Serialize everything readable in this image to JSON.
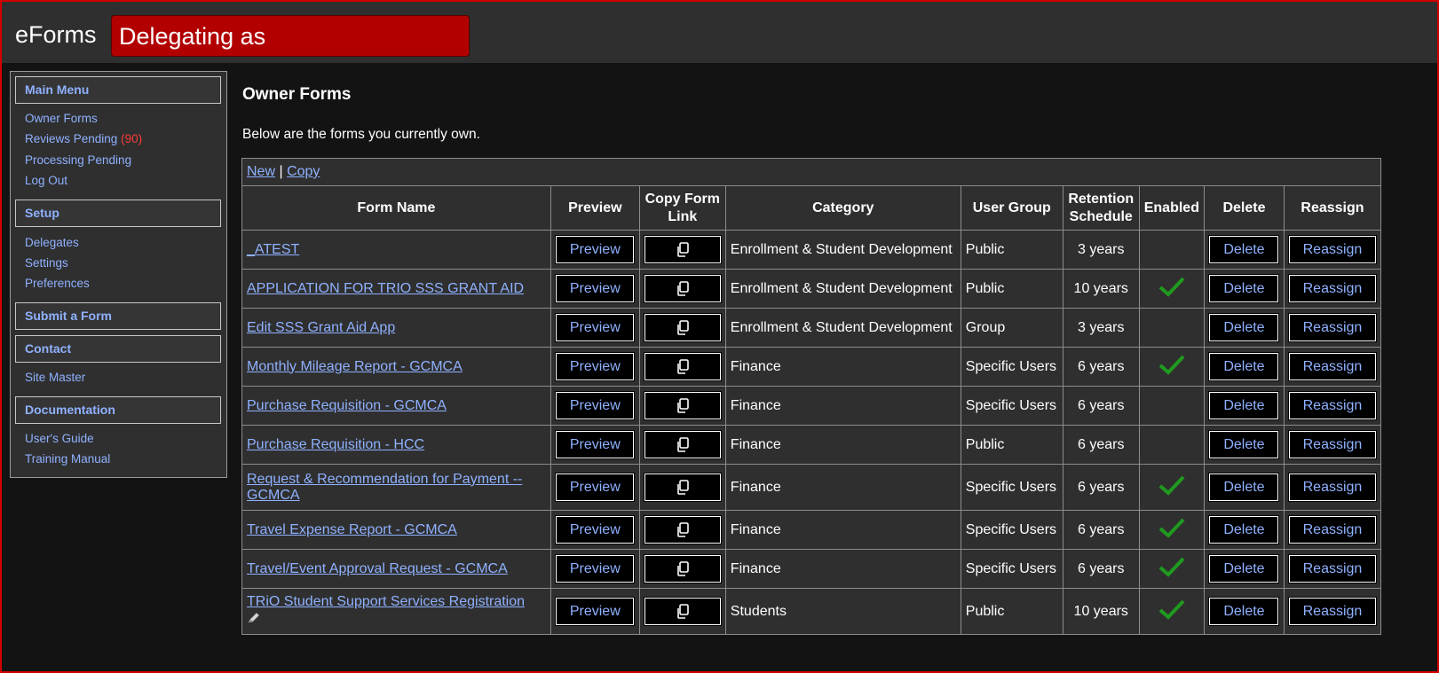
{
  "header": {
    "app_title": "eForms",
    "delegate_banner": "Delegating as"
  },
  "sidebar": {
    "main_menu": {
      "title": "Main Menu",
      "items": [
        {
          "label": "Owner Forms"
        },
        {
          "label": "Reviews Pending",
          "count": "(90)"
        },
        {
          "label": "Processing Pending"
        },
        {
          "label": "Log Out"
        }
      ]
    },
    "setup": {
      "title": "Setup",
      "items": [
        {
          "label": "Delegates"
        },
        {
          "label": "Settings"
        },
        {
          "label": "Preferences"
        }
      ]
    },
    "submit_form": {
      "title": "Submit a Form"
    },
    "contact": {
      "title": "Contact",
      "items": [
        {
          "label": "Site Master"
        }
      ]
    },
    "documentation": {
      "title": "Documentation",
      "items": [
        {
          "label": "User's Guide"
        },
        {
          "label": "Training Manual"
        }
      ]
    }
  },
  "main": {
    "title": "Owner Forms",
    "intro": "Below are the forms you currently own.",
    "toolbar": {
      "new": "New",
      "separator": "|",
      "copy": "Copy"
    },
    "columns": [
      "Form Name",
      "Preview",
      "Copy Form Link",
      "Category",
      "User Group",
      "Retention Schedule",
      "Enabled",
      "Delete",
      "Reassign"
    ],
    "button_labels": {
      "preview": "Preview",
      "delete": "Delete",
      "reassign": "Reassign"
    },
    "icons": {
      "copy": "copy-icon",
      "enabled": "checkmark-icon",
      "edit": "pencil-icon"
    },
    "colors": {
      "link": "#8fb1ff",
      "check": "#1f9a1f",
      "banner": "#b20000",
      "count": "#ff3a3a"
    },
    "rows": [
      {
        "name": "_ATEST",
        "category": "Enrollment & Student Development",
        "group": "Public",
        "retention": "3 years",
        "enabled": false
      },
      {
        "name": "APPLICATION FOR TRIO SSS GRANT AID",
        "category": "Enrollment & Student Development",
        "group": "Public",
        "retention": "10 years",
        "enabled": true
      },
      {
        "name": "Edit SSS Grant Aid App",
        "category": "Enrollment & Student Development",
        "group": "Group",
        "retention": "3 years",
        "enabled": false
      },
      {
        "name": "Monthly Mileage Report - GCMCA",
        "category": "Finance",
        "group": "Specific Users",
        "retention": "6 years",
        "enabled": true
      },
      {
        "name": "Purchase Requisition - GCMCA",
        "category": "Finance",
        "group": "Specific Users",
        "retention": "6 years",
        "enabled": false
      },
      {
        "name": "Purchase Requisition - HCC",
        "category": "Finance",
        "group": "Public",
        "retention": "6 years",
        "enabled": false
      },
      {
        "name": "Request & Recommendation for Payment -- GCMCA",
        "category": "Finance",
        "group": "Specific Users",
        "retention": "6 years",
        "enabled": true
      },
      {
        "name": "Travel Expense Report - GCMCA",
        "category": "Finance",
        "group": "Specific Users",
        "retention": "6 years",
        "enabled": true
      },
      {
        "name": "Travel/Event Approval Request - GCMCA",
        "category": "Finance",
        "group": "Specific Users",
        "retention": "6 years",
        "enabled": true
      },
      {
        "name": "TRiO Student Support Services Registration",
        "category": "Students",
        "group": "Public",
        "retention": "10 years",
        "enabled": true,
        "has_edit_icon": true
      }
    ]
  }
}
